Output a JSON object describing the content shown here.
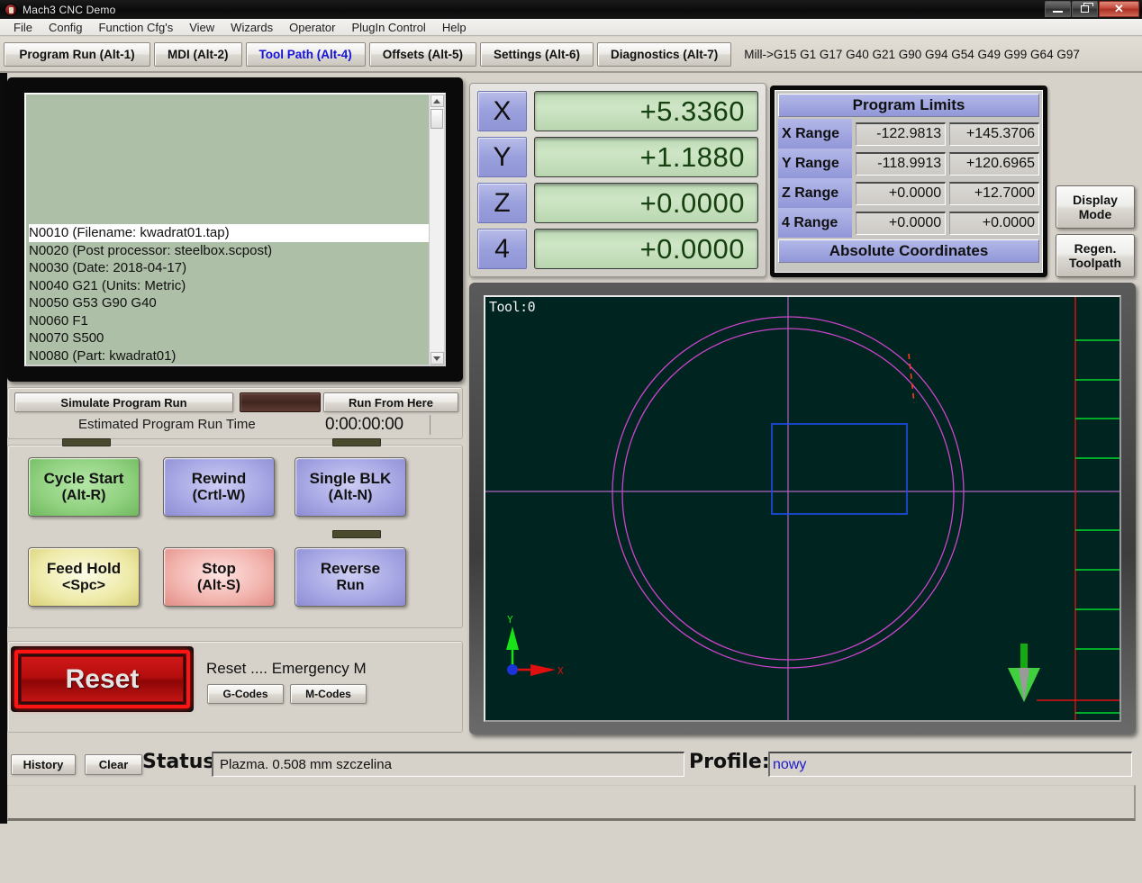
{
  "window": {
    "title": "Mach3 CNC  Demo",
    "icon": "mach3-logo-icon",
    "controls": {
      "minimize": "minimize-icon",
      "maximize": "maximize-icon",
      "close": "✕"
    }
  },
  "menu": {
    "items": [
      "File",
      "Config",
      "Function Cfg's",
      "View",
      "Wizards",
      "Operator",
      "PlugIn Control",
      "Help"
    ]
  },
  "tabs": {
    "items": [
      {
        "label": "Program Run (Alt-1)",
        "active": false
      },
      {
        "label": "MDI (Alt-2)",
        "active": false
      },
      {
        "label": "Tool Path (Alt-4)",
        "active": true
      },
      {
        "label": "Offsets (Alt-5)",
        "active": false
      },
      {
        "label": "Settings (Alt-6)",
        "active": false
      },
      {
        "label": "Diagnostics (Alt-7)",
        "active": false
      }
    ],
    "modal_state": "Mill->G15   G1 G17 G40 G21 G90 G94 G54 G49 G99 G64 G97"
  },
  "gcode": {
    "lines": [
      {
        "text": "N0010 (Filename: kwadrat01.tap)",
        "selected": true
      },
      {
        "text": "N0020 (Post processor: steelbox.scpost)",
        "selected": false
      },
      {
        "text": "N0030 (Date: 2018-04-17)",
        "selected": false
      },
      {
        "text": "N0040 G21 (Units: Metric)",
        "selected": false
      },
      {
        "text": "N0050 G53 G90 G40",
        "selected": false
      },
      {
        "text": "N0060 F1",
        "selected": false
      },
      {
        "text": "N0070 S500",
        "selected": false
      },
      {
        "text": "N0080 (Part: kwadrat01)",
        "selected": false
      }
    ],
    "scrollbar": {
      "up": "scroll-up-arrow-icon",
      "down": "scroll-down-arrow-icon"
    }
  },
  "run_bar": {
    "simulate_label": "Simulate Program Run",
    "run_from_here_label": "Run From Here",
    "estimated_label": "Estimated Program Run Time",
    "estimated_value": "0:00:00:00"
  },
  "controls": {
    "buttons": [
      {
        "line1": "Cycle Start",
        "line2": "(Alt-R)",
        "color": "green"
      },
      {
        "line1": "Rewind",
        "line2": "(Crtl-W)",
        "color": "blue"
      },
      {
        "line1": "Single BLK",
        "line2": "(Alt-N)",
        "color": "blue"
      },
      {
        "line1": "Feed Hold",
        "line2": "<Spc>",
        "color": "yellow"
      },
      {
        "line1": "Stop",
        "line2": "(Alt-S)",
        "color": "red"
      },
      {
        "line1": "Reverse",
        "line2": "Run",
        "color": "blue"
      }
    ]
  },
  "reset": {
    "label": "Reset",
    "message": "Reset .... Emergency M",
    "gcodes_label": "G-Codes",
    "mcodes_label": "M-Codes"
  },
  "dro": {
    "axes": [
      {
        "name": "X",
        "value": "+5.3360"
      },
      {
        "name": "Y",
        "value": "+1.1880"
      },
      {
        "name": "Z",
        "value": "+0.0000"
      },
      {
        "name": "4",
        "value": "+0.0000"
      }
    ]
  },
  "program_limits": {
    "title": "Program Limits",
    "footer": "Absolute Coordinates",
    "rows": [
      {
        "name": "X Range",
        "min": "-122.9813",
        "max": "+145.3706"
      },
      {
        "name": "Y Range",
        "min": "-118.9913",
        "max": "+120.6965"
      },
      {
        "name": "Z Range",
        "min": "+0.0000",
        "max": "+12.7000"
      },
      {
        "name": "4 Range",
        "min": "+0.0000",
        "max": "+0.0000"
      }
    ]
  },
  "side_buttons": {
    "display_mode": {
      "line1": "Display",
      "line2": "Mode"
    },
    "regen_toolpath": {
      "line1": "Regen.",
      "line2": "Toolpath"
    }
  },
  "toolpath": {
    "tool_label": "Tool:0",
    "background": "#00241f",
    "path_color": "#cc44cc",
    "axis_color": "#b060c0",
    "rapid_color": "#ff3b1e",
    "extents_color": "#1b4ff0",
    "limit_color": "#e01010",
    "tick_color": "#00d82a"
  },
  "status_bar": {
    "history_label": "History",
    "clear_label": "Clear",
    "status_label": "Status:",
    "status_text": "Plazma. 0.508 mm szczelina",
    "profile_label": "Profile:",
    "profile_value": "nowy"
  }
}
